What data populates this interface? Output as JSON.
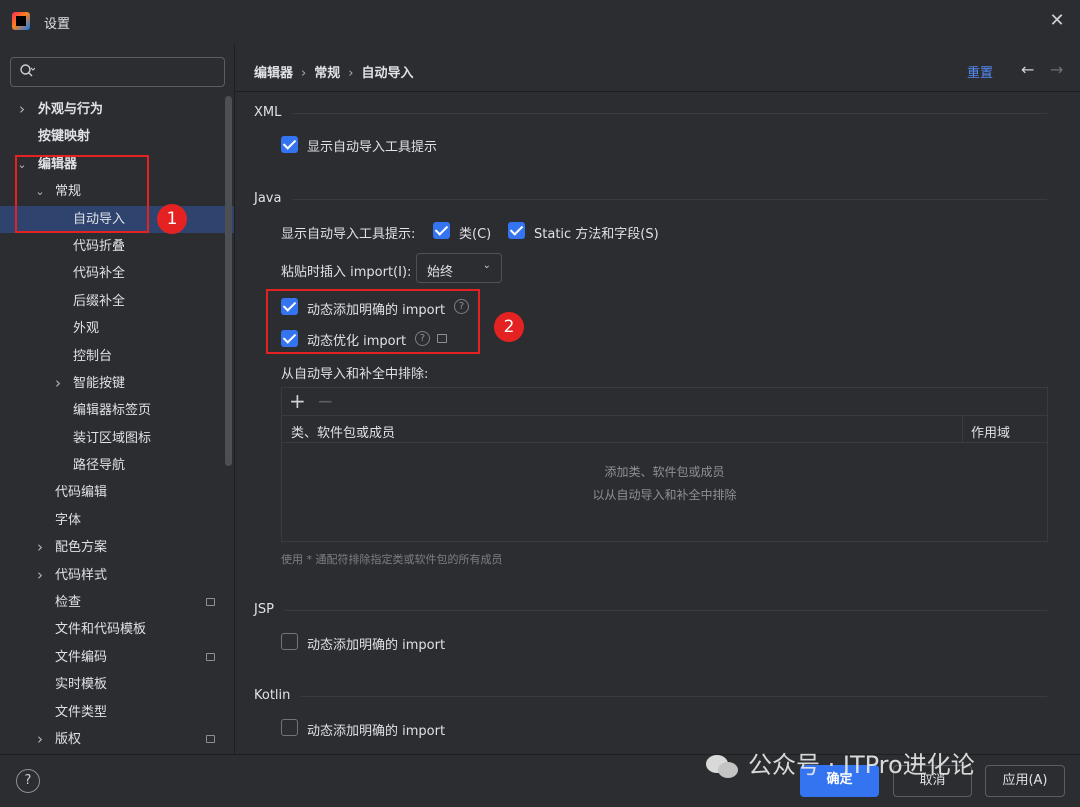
{
  "window": {
    "title": "设置"
  },
  "search": {
    "placeholder": ""
  },
  "sidebar": {
    "items": [
      {
        "label": "外观与行为",
        "level": 0,
        "bold": true,
        "chevron": "right"
      },
      {
        "label": "按键映射",
        "level": 0,
        "bold": true,
        "chevron": ""
      },
      {
        "label": "编辑器",
        "level": 0,
        "bold": true,
        "chevron": "down"
      },
      {
        "label": "常规",
        "level": 1,
        "bold": false,
        "chevron": "down"
      },
      {
        "label": "自动导入",
        "level": 2,
        "bold": false,
        "chevron": "",
        "selected": true
      },
      {
        "label": "代码折叠",
        "level": 2,
        "bold": false,
        "chevron": ""
      },
      {
        "label": "代码补全",
        "level": 2,
        "bold": false,
        "chevron": ""
      },
      {
        "label": "后缀补全",
        "level": 2,
        "bold": false,
        "chevron": ""
      },
      {
        "label": "外观",
        "level": 2,
        "bold": false,
        "chevron": ""
      },
      {
        "label": "控制台",
        "level": 2,
        "bold": false,
        "chevron": ""
      },
      {
        "label": "智能按键",
        "level": 2,
        "bold": false,
        "chevron": "right"
      },
      {
        "label": "编辑器标签页",
        "level": 2,
        "bold": false,
        "chevron": ""
      },
      {
        "label": "装订区域图标",
        "level": 2,
        "bold": false,
        "chevron": ""
      },
      {
        "label": "路径导航",
        "level": 2,
        "bold": false,
        "chevron": ""
      },
      {
        "label": "代码编辑",
        "level": 1,
        "bold": false,
        "chevron": ""
      },
      {
        "label": "字体",
        "level": 1,
        "bold": false,
        "chevron": ""
      },
      {
        "label": "配色方案",
        "level": 1,
        "bold": false,
        "chevron": "right"
      },
      {
        "label": "代码样式",
        "level": 1,
        "bold": false,
        "chevron": "right"
      },
      {
        "label": "检查",
        "level": 1,
        "bold": false,
        "chevron": "",
        "icon": true
      },
      {
        "label": "文件和代码模板",
        "level": 1,
        "bold": false,
        "chevron": ""
      },
      {
        "label": "文件编码",
        "level": 1,
        "bold": false,
        "chevron": "",
        "icon": true
      },
      {
        "label": "实时模板",
        "level": 1,
        "bold": false,
        "chevron": ""
      },
      {
        "label": "文件类型",
        "level": 1,
        "bold": false,
        "chevron": ""
      },
      {
        "label": "版权",
        "level": 1,
        "bold": false,
        "chevron": "right",
        "icon": true
      }
    ]
  },
  "breadcrumb": [
    "编辑器",
    "常规",
    "自动导入"
  ],
  "header": {
    "reset": "重置"
  },
  "xml": {
    "title": "XML",
    "show_popup": {
      "label": "显示自动导入工具提示",
      "checked": true
    }
  },
  "java": {
    "title": "Java",
    "show_popup_label": "显示自动导入工具提示:",
    "classes": {
      "label": "类(C)",
      "checked": true
    },
    "static_members": {
      "label": "Static 方法和字段(S)",
      "checked": true
    },
    "paste_label": "粘贴时插入 import(I):",
    "paste_value": "始终",
    "add_unambiguous": {
      "label": "动态添加明确的 import",
      "checked": true
    },
    "optimize": {
      "label": "动态优化 import",
      "checked": true
    },
    "exclude_label": "从自动导入和补全中排除:",
    "table": {
      "col_name": "类、软件包或成员",
      "col_scope": "作用域"
    },
    "empty_line1": "添加类、软件包或成员",
    "empty_line2": "以从自动导入和补全中排除",
    "hint": "使用 * 通配符排除指定类或软件包的所有成员"
  },
  "jsp": {
    "title": "JSP",
    "add_unambiguous": {
      "label": "动态添加明确的 import",
      "checked": false
    }
  },
  "kotlin": {
    "title": "Kotlin",
    "add_unambiguous": {
      "label": "动态添加明确的 import",
      "checked": false
    }
  },
  "footer": {
    "help": "?",
    "ok": "确定",
    "cancel": "取消",
    "apply": "应用(A)"
  },
  "annotations": {
    "one": "1",
    "two": "2"
  },
  "watermark": "公众号 · ITPro进化论",
  "colors": {
    "accent": "#3574f0",
    "selection": "#2e436e",
    "annotation": "#e52222",
    "link": "#548af7"
  }
}
